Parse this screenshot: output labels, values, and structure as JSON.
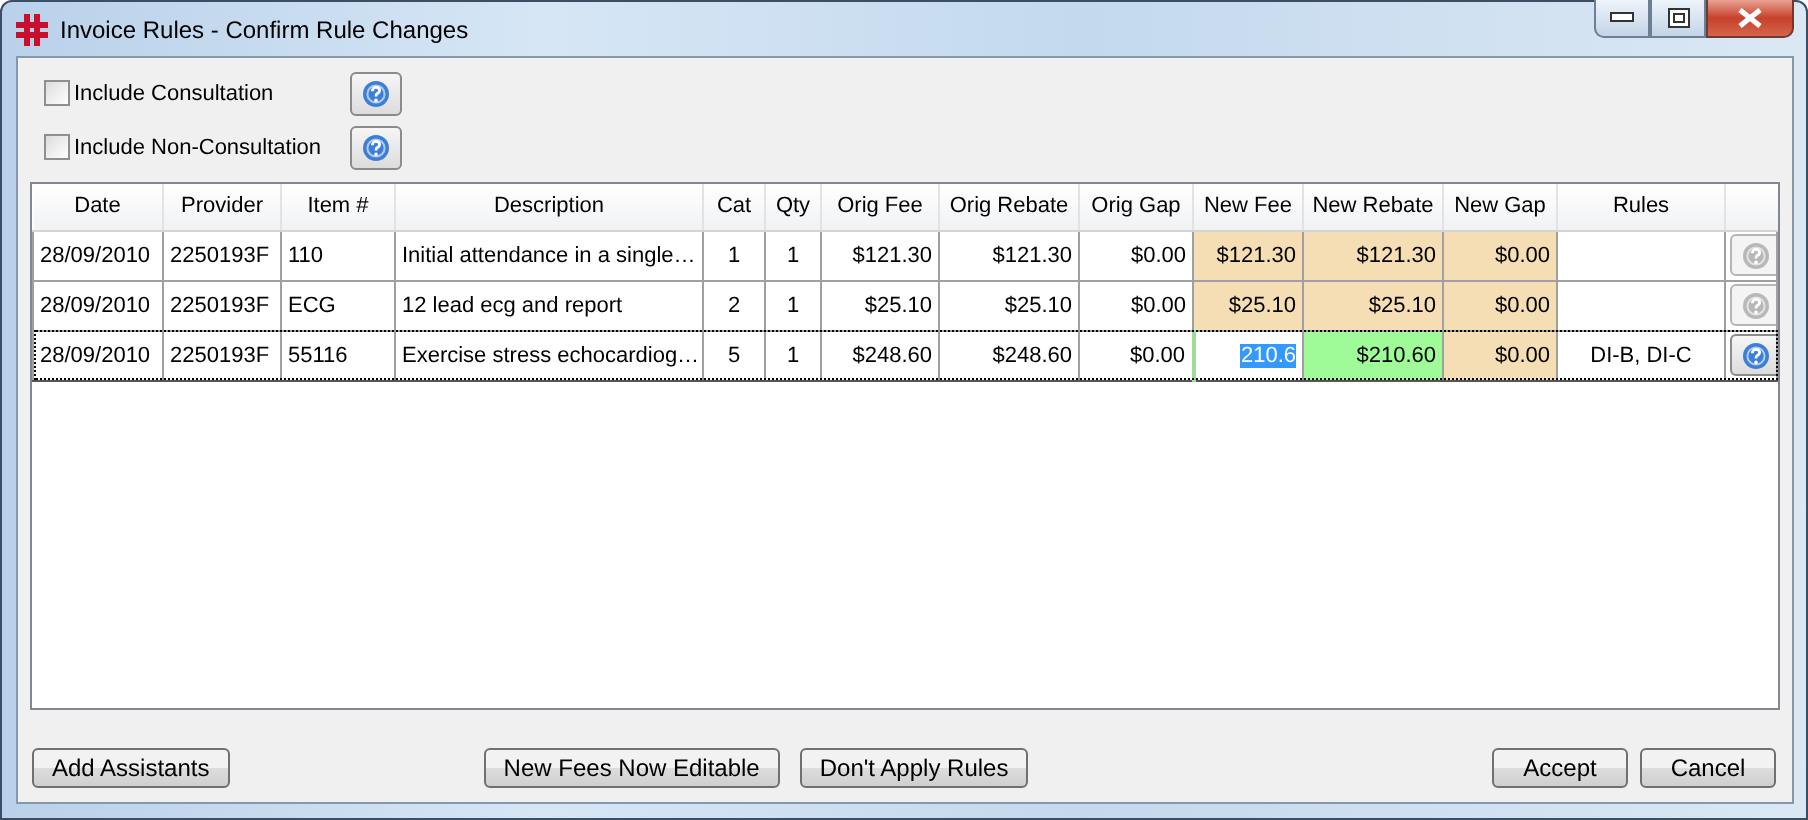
{
  "window": {
    "title": "Invoice Rules - Confirm Rule Changes"
  },
  "options": [
    {
      "label": "Include Consultation",
      "checked": false
    },
    {
      "label": "Include Non-Consultation",
      "checked": false
    }
  ],
  "table": {
    "columns": [
      "Date",
      "Provider",
      "Item #",
      "Description",
      "Cat",
      "Qty",
      "Orig Fee",
      "Orig Rebate",
      "Orig Gap",
      "New Fee",
      "New Rebate",
      "New Gap",
      "Rules"
    ],
    "rows": [
      {
        "date": "28/09/2010",
        "provider": "2250193F",
        "item": "110",
        "description": "Initial attendance in a single…",
        "cat": "1",
        "qty": "1",
        "orig_fee": "$121.30",
        "orig_rebate": "$121.30",
        "orig_gap": "$0.00",
        "new_fee": {
          "text": "$121.30",
          "kind": "plain"
        },
        "new_rebate": {
          "text": "$121.30",
          "kind": "plain"
        },
        "new_gap": {
          "text": "$0.00",
          "kind": "plain"
        },
        "focused": false,
        "help_disabled": true
      },
      {
        "date": "28/09/2010",
        "provider": "2250193F",
        "item": "ECG",
        "description": "12 lead ecg and report",
        "cat": "2",
        "qty": "1",
        "orig_fee": "$25.10",
        "orig_rebate": "$25.10",
        "orig_gap": "$0.00",
        "new_fee": {
          "text": "$25.10",
          "kind": "plain"
        },
        "new_rebate": {
          "text": "$25.10",
          "kind": "plain"
        },
        "new_gap": {
          "text": "$0.00",
          "kind": "plain"
        },
        "focused": false,
        "help_disabled": true
      },
      {
        "date": "28/09/2010",
        "provider": "2250193F",
        "item": "55116",
        "description": "Exercise stress echocardiog…",
        "cat": "5",
        "qty": "1",
        "orig_fee": "$248.60",
        "orig_rebate": "$248.60",
        "orig_gap": "$0.00",
        "new_fee": {
          "text": "210.6",
          "kind": "editing"
        },
        "new_rebate": {
          "text": "$210.60",
          "kind": "changed"
        },
        "new_gap": {
          "text": "$0.00",
          "kind": "plain"
        },
        "rules": "DI-B,  DI-C",
        "focused": true,
        "help_disabled": false
      }
    ]
  },
  "buttons": {
    "left": [
      "Add Assistants"
    ],
    "center": [
      "New Fees Now Editable",
      "Don't Apply Rules"
    ],
    "right": [
      "Accept",
      "Cancel"
    ]
  }
}
